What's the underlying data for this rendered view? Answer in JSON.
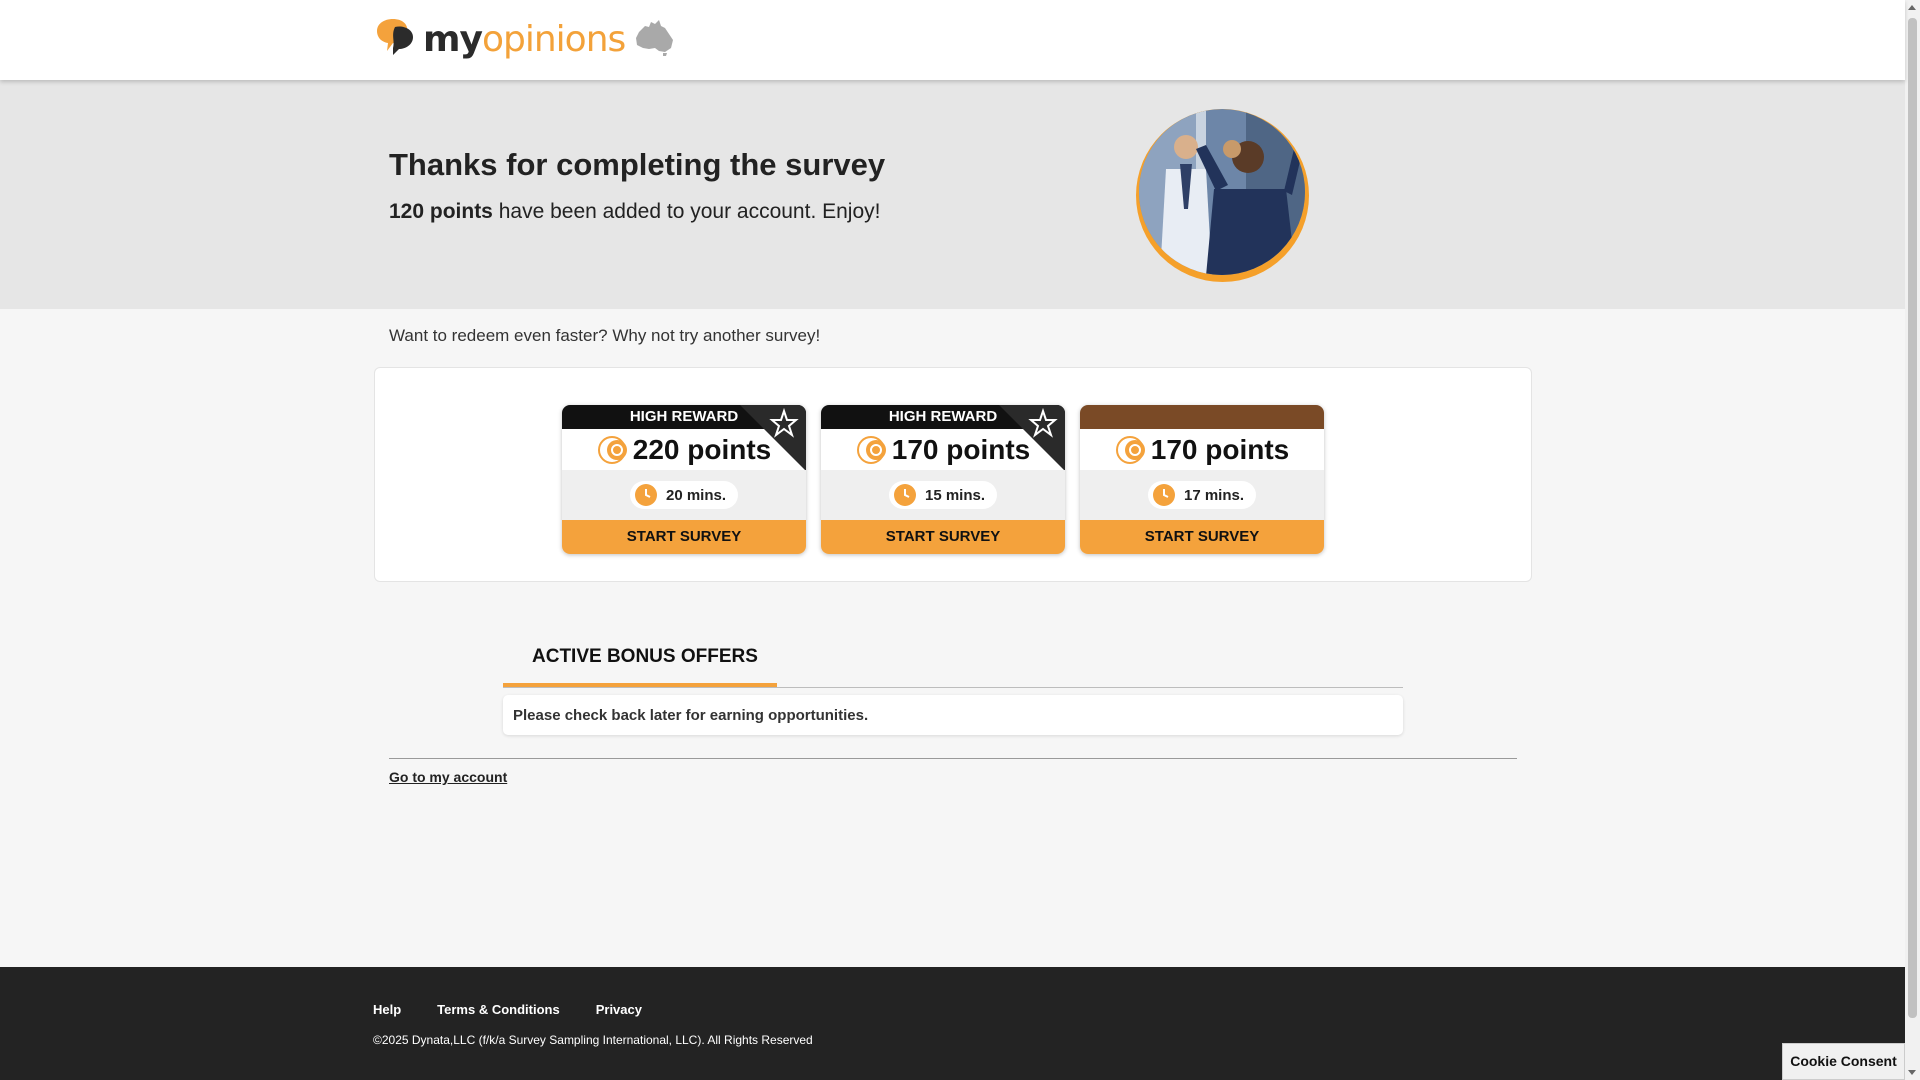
{
  "brand": {
    "name_part1": "my",
    "name_part2": "opinions",
    "accent": "#f4a23c"
  },
  "hero": {
    "title": "Thanks for completing the survey",
    "points_bold": "120 points",
    "points_rest": " have been added to your account. Enjoy!"
  },
  "redeem_text": "Want to redeem even faster? Why not try another survey!",
  "surveys": [
    {
      "tag": "HIGH REWARD",
      "points": "220 points",
      "time": "20 mins.",
      "button": "START SURVEY"
    },
    {
      "tag": "HIGH REWARD",
      "points": "170 points",
      "time": "15 mins.",
      "button": "START SURVEY"
    },
    {
      "tag": "",
      "points": "170 points",
      "time": "17 mins.",
      "button": "START SURVEY"
    }
  ],
  "bonus": {
    "tab_label": "ACTIVE BONUS OFFERS",
    "message": "Please check back later for earning opportunities."
  },
  "account_link": "Go to my account",
  "footer": {
    "links": [
      "Help",
      "Terms & Conditions",
      "Privacy"
    ],
    "copyright": "©2025 Dynata,LLC (f/k/a Survey Sampling International, LLC). All Rights Reserved"
  },
  "cookie_button": "Cookie Consent",
  "icons": {
    "logo": "speech-bubble-logo-icon",
    "country": "australia-map-icon",
    "points": "coin-icon",
    "time": "clock-icon",
    "reward": "star-icon"
  }
}
